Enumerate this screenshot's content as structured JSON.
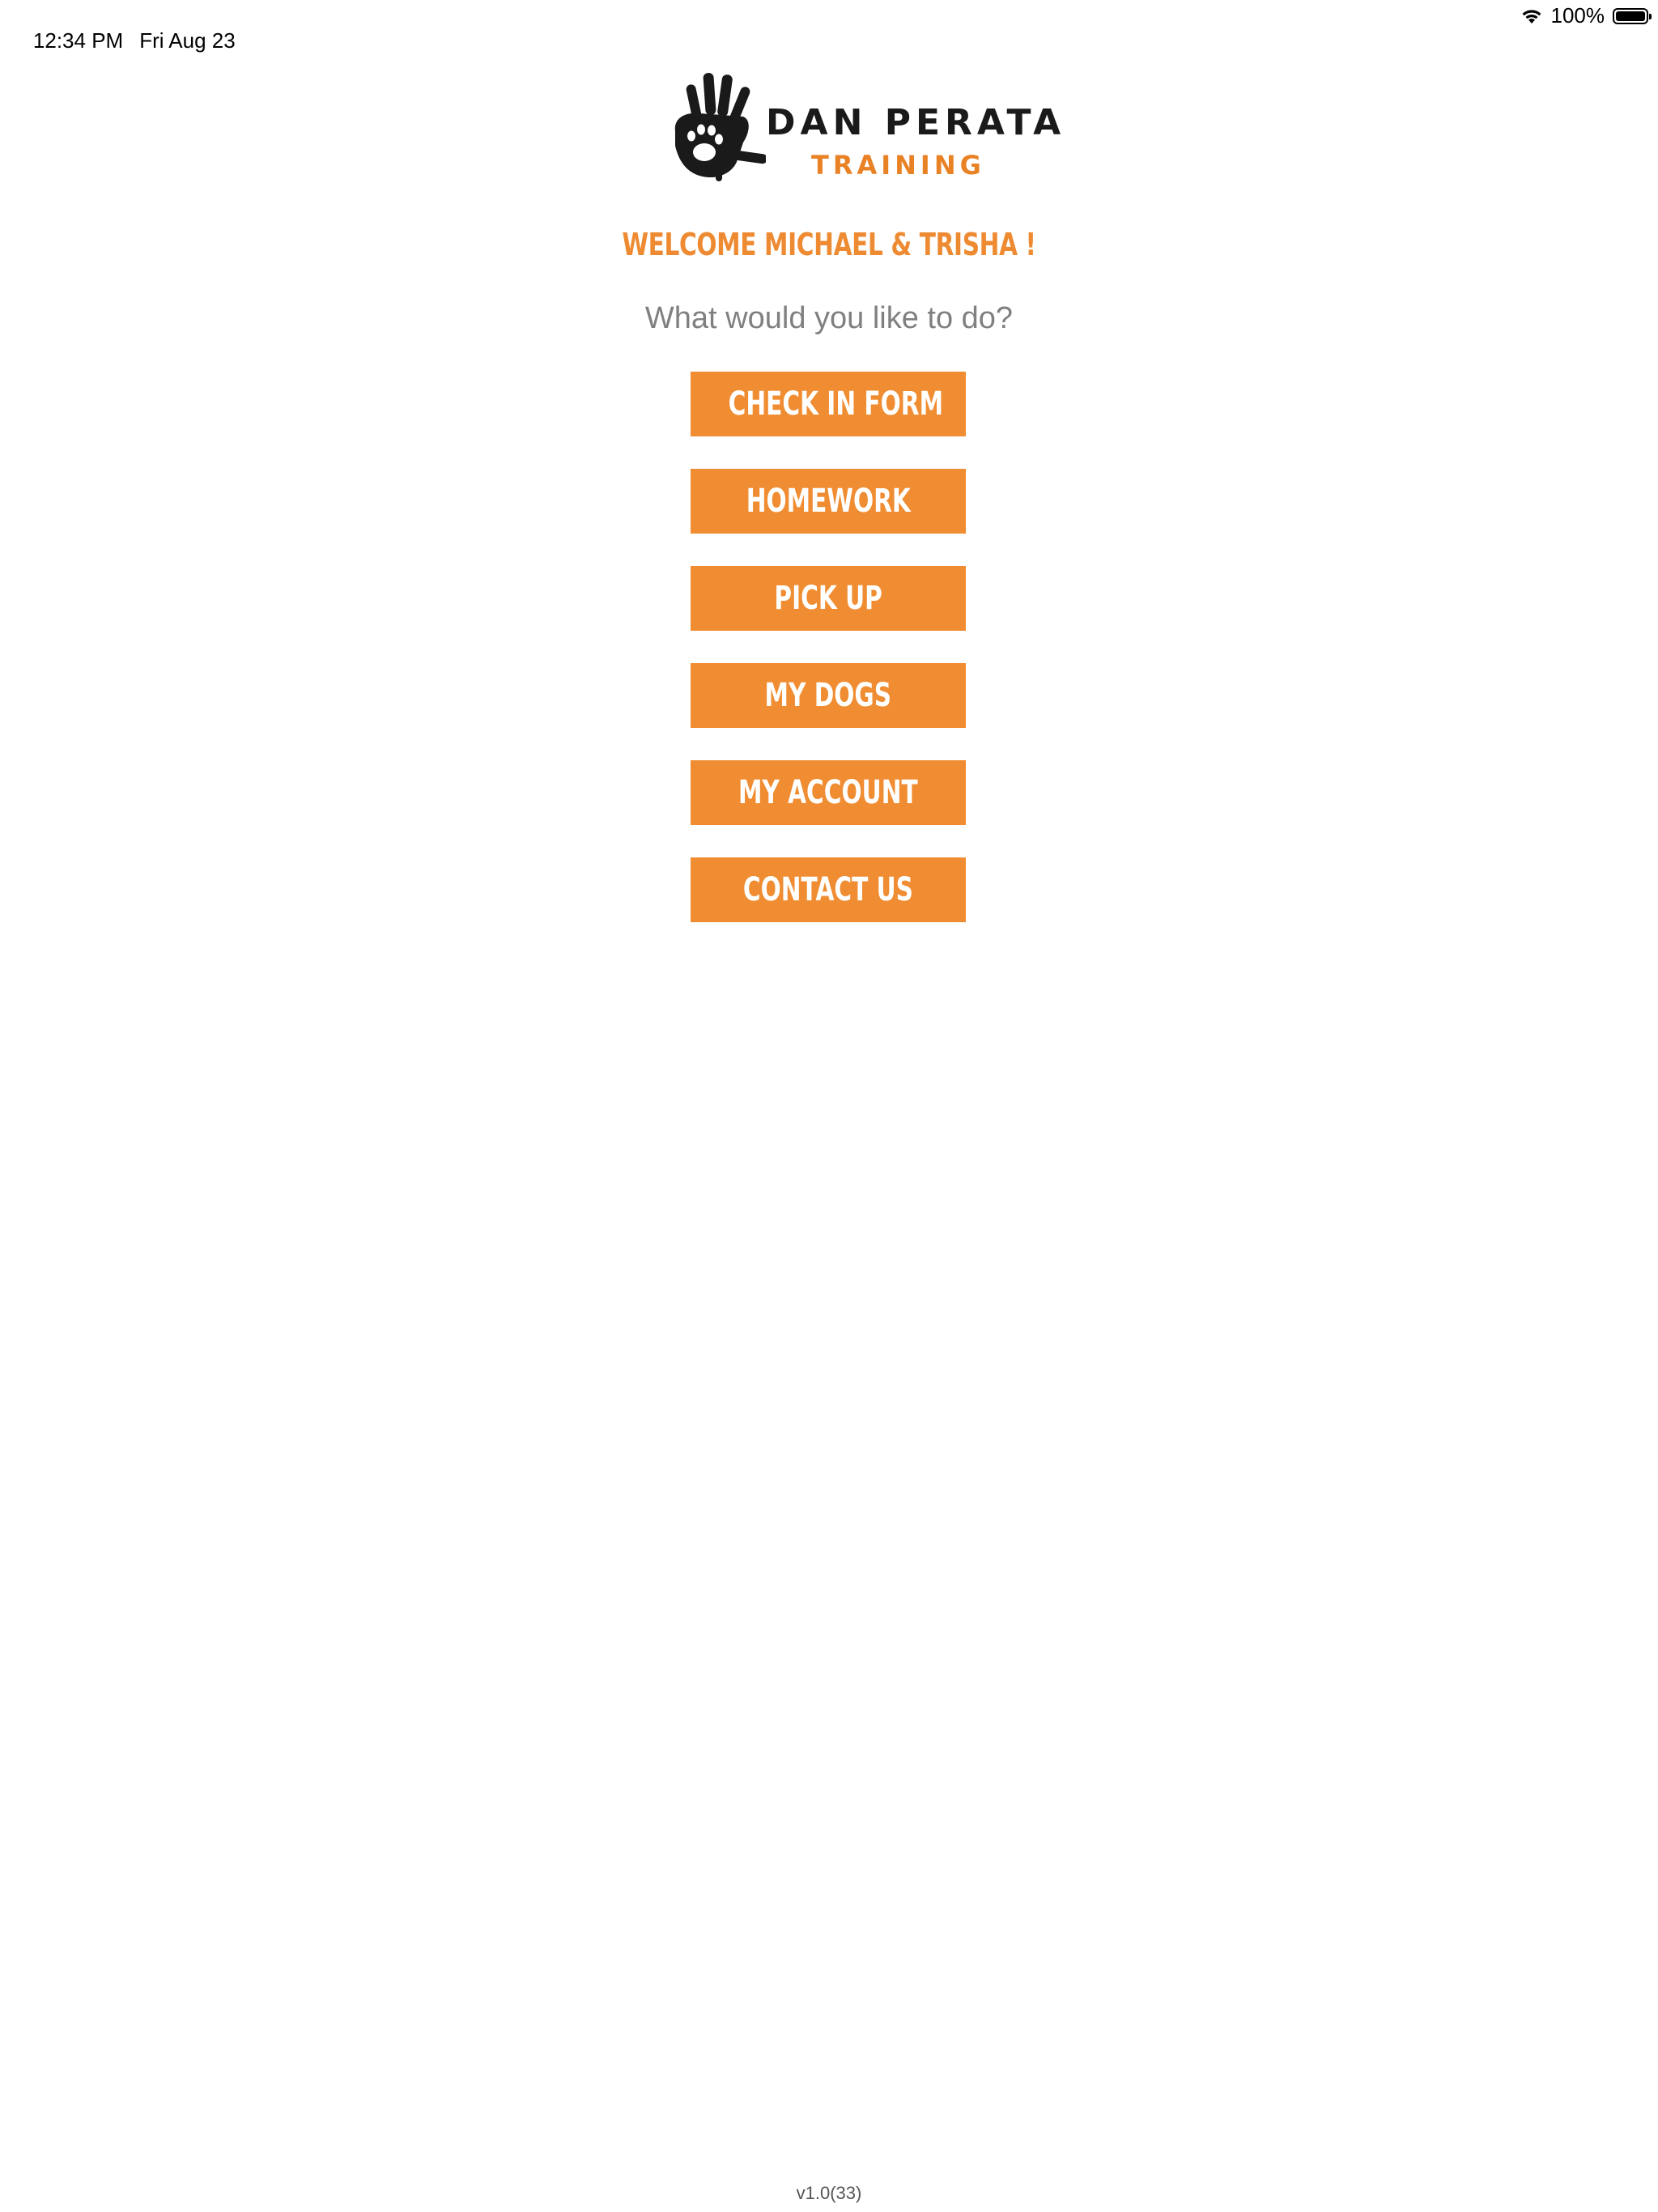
{
  "status_bar": {
    "time": "12:34 PM",
    "date": "Fri Aug 23",
    "battery_percent": "100%",
    "battery_level": 1.0
  },
  "logo": {
    "title": "DAN PERATA",
    "subtitle": "TRAINING",
    "brand_color": "#e98125"
  },
  "welcome": "WELCOME MICHAEL & TRISHA !",
  "prompt": "What would you like to do?",
  "menu": {
    "accent_color": "#f08c31",
    "items": [
      {
        "label": "CHECK IN FORM"
      },
      {
        "label": "HOMEWORK"
      },
      {
        "label": "PICK UP"
      },
      {
        "label": "MY DOGS"
      },
      {
        "label": "MY ACCOUNT"
      },
      {
        "label": "CONTACT US"
      }
    ]
  },
  "version": "v1.0(33)"
}
